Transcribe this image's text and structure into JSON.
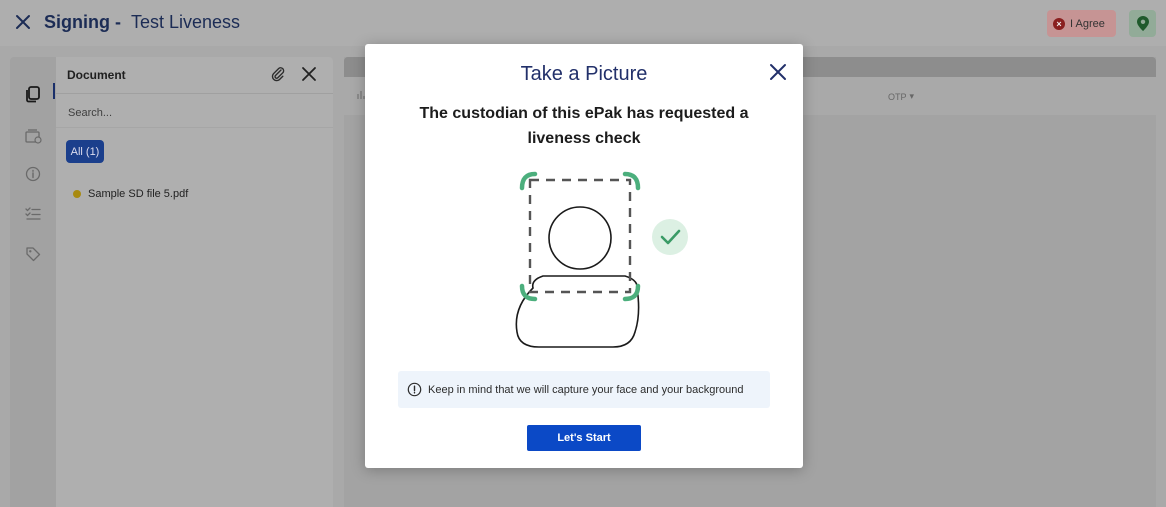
{
  "header": {
    "title_prefix": "Signing -",
    "title_name": "Test Liveness",
    "agree_label": "I Agree",
    "close_icon": "close-icon",
    "location_icon": "location-pin-icon"
  },
  "leftrail": {
    "items": [
      {
        "icon": "documents-icon",
        "active": true
      },
      {
        "icon": "wallet-icon"
      },
      {
        "icon": "info-icon"
      },
      {
        "icon": "checklist-icon"
      },
      {
        "icon": "tag-icon"
      }
    ]
  },
  "document_panel": {
    "title": "Document",
    "search_placeholder": "Search...",
    "filter_chip": "All (1)",
    "files": [
      {
        "name": "Sample SD file 5.pdf",
        "status_color": "#f0c419"
      }
    ]
  },
  "main": {
    "columns": [
      "OTP"
    ]
  },
  "modal": {
    "title": "Take a Picture",
    "subtitle": "The custodian of this ePak has requested a liveness check",
    "notice": "Keep in mind that we will capture your face and your background",
    "start_button": "Let's Start",
    "illustration_icon": "face-capture-illustration",
    "check_icon": "check-icon"
  },
  "colors": {
    "title_blue": "#22306a",
    "primary_button": "#0b49c6",
    "frame_green": "#4caf7d",
    "notice_bg": "#eef4fb",
    "agree_red": "#d32f2f"
  }
}
